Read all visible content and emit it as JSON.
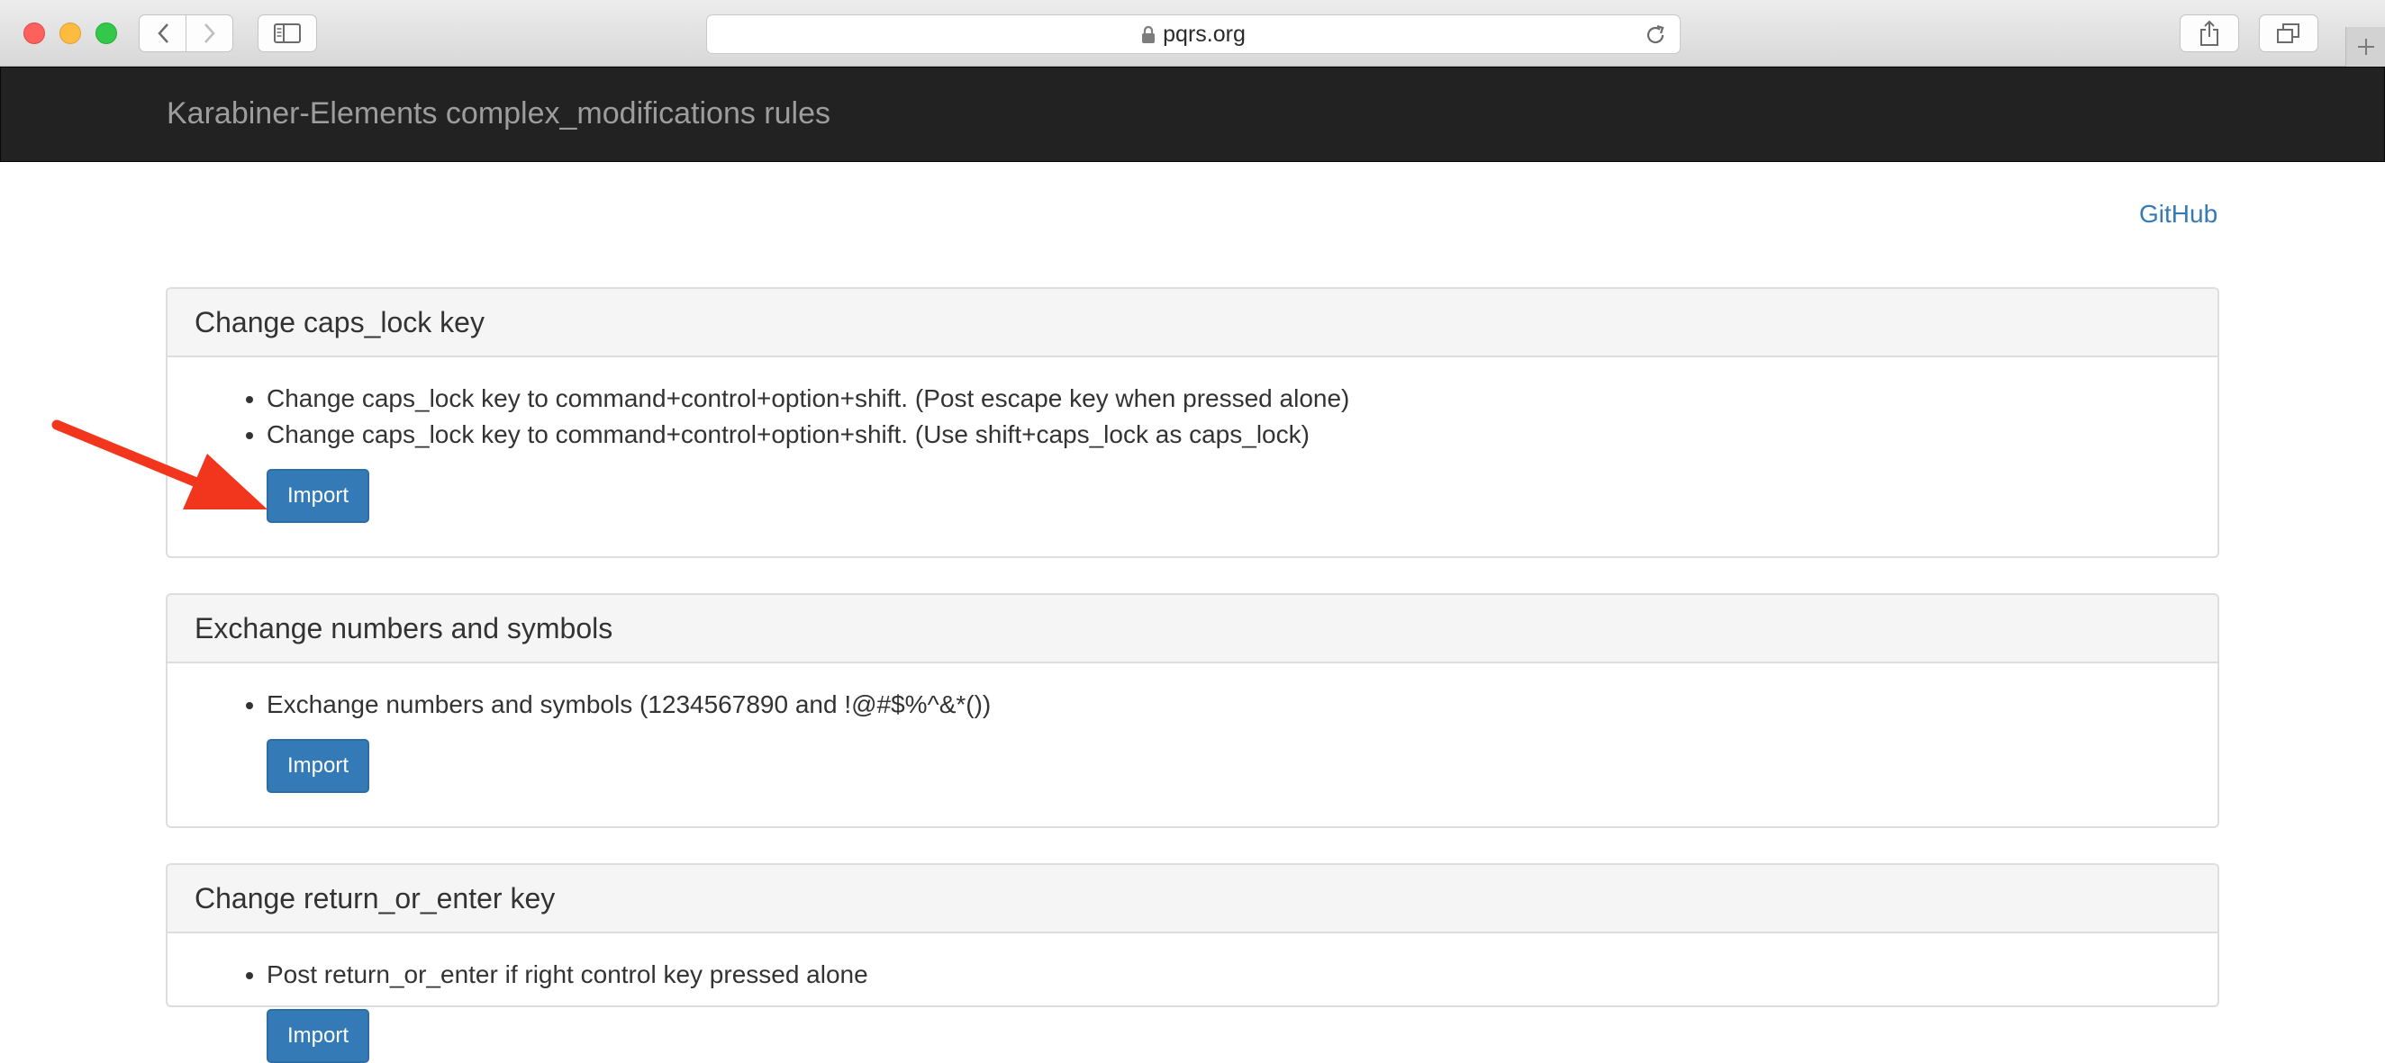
{
  "browser": {
    "url": "pqrs.org",
    "icons": [
      "back-icon",
      "forward-icon",
      "sidebar-icon",
      "lock-icon",
      "reload-icon",
      "share-icon",
      "tabs-icon",
      "new-tab-icon"
    ]
  },
  "navbar": {
    "brand": "Karabiner-Elements complex_modifications rules"
  },
  "links": {
    "github": "GitHub"
  },
  "panels": [
    {
      "title": "Change caps_lock key",
      "items": [
        "Change caps_lock key to command+control+option+shift. (Post escape key when pressed alone)",
        "Change caps_lock key to command+control+option+shift. (Use shift+caps_lock as caps_lock)"
      ],
      "button": "Import"
    },
    {
      "title": "Exchange numbers and symbols",
      "items": [
        "Exchange numbers and symbols (1234567890 and !@#$%^&*())"
      ],
      "button": "Import"
    },
    {
      "title": "Change return_or_enter key",
      "items": [
        "Post return_or_enter if right control key pressed alone"
      ],
      "button": "Import"
    }
  ],
  "colors": {
    "navbar_bg": "#222222",
    "brand_text": "#9d9d9d",
    "link": "#337ab7",
    "button_primary": "#337ab7",
    "annotation_arrow": "#f2361d"
  }
}
